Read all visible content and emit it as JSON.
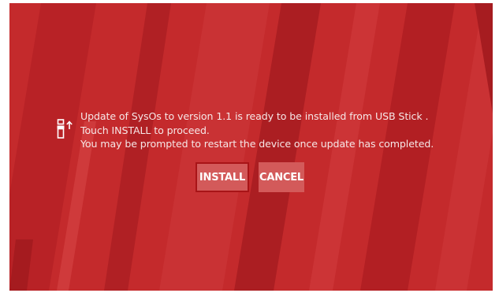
{
  "screen": {
    "background_color": "#c42a2c"
  },
  "dialog": {
    "icon": "usb-update-icon",
    "message_lines": [
      "Update of SysOs to version 1.1 is ready to be installed from USB Stick .",
      "Touch INSTALL to proceed.",
      "You may be prompted to restart the device once update has completed."
    ],
    "install_label": "INSTALL",
    "cancel_label": "CANCEL",
    "button_color": "#d35a5a",
    "focus_border_color": "#a81417"
  }
}
